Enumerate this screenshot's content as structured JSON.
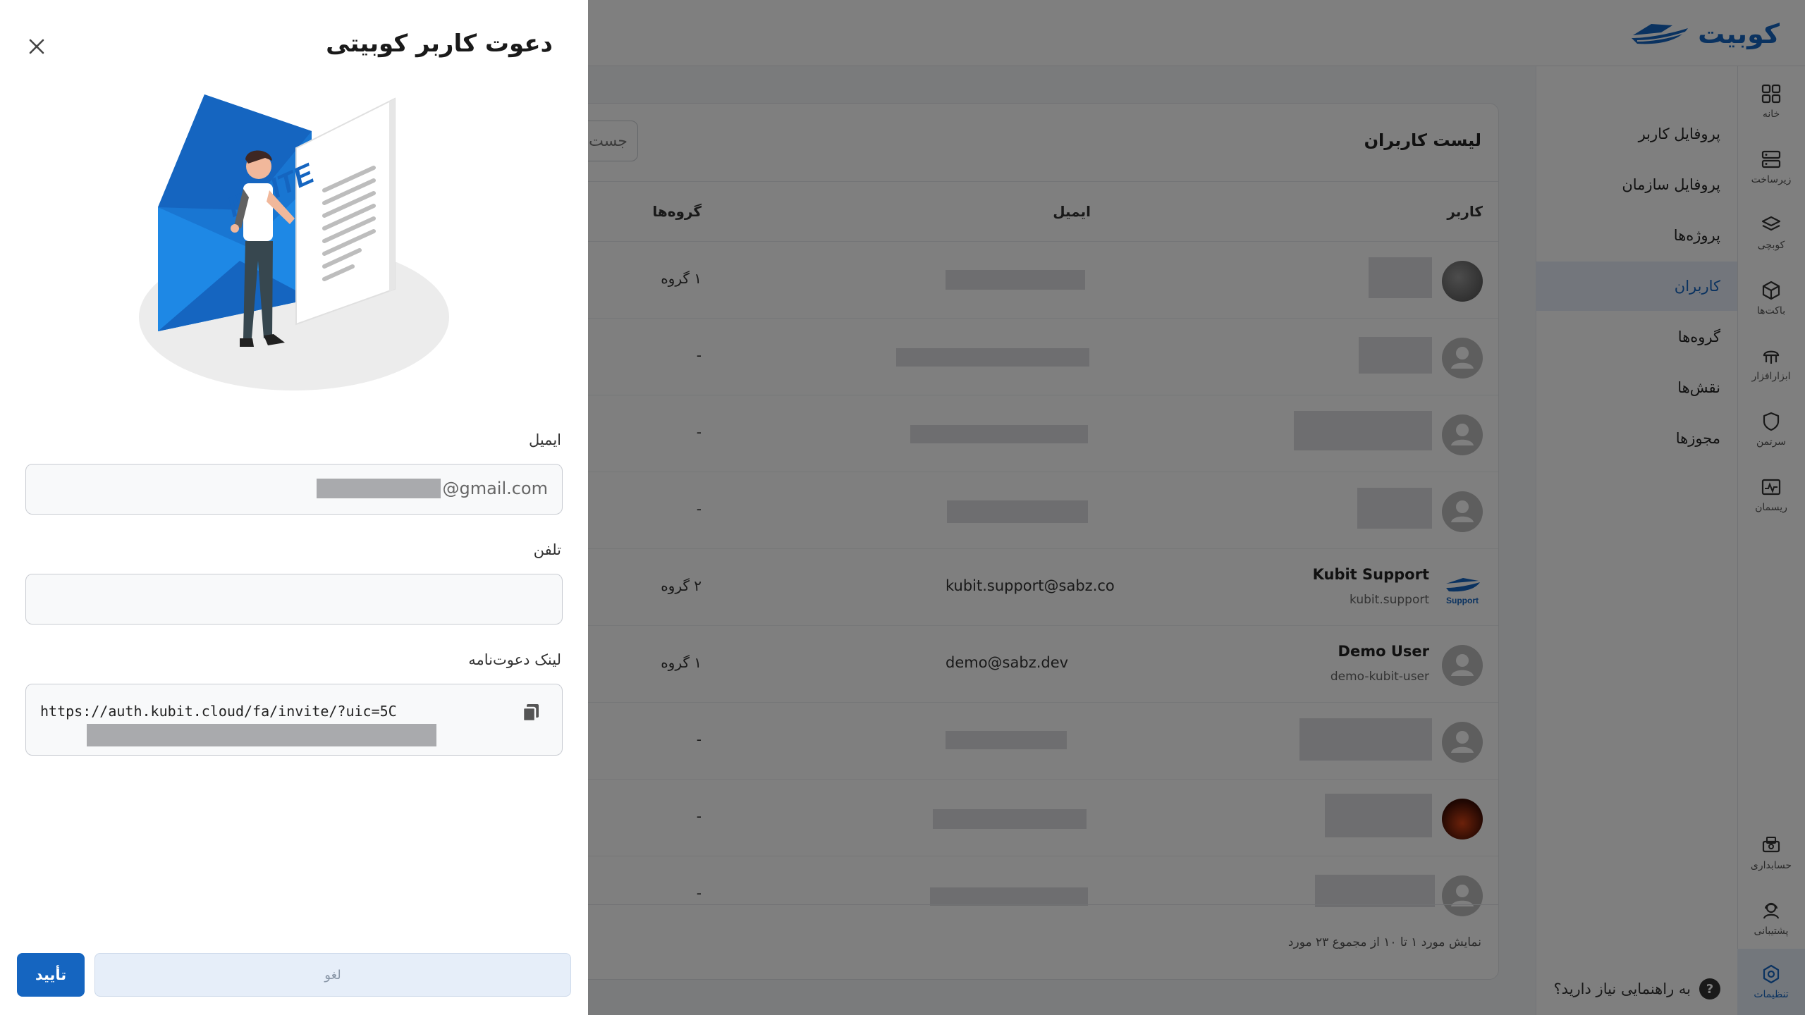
{
  "brand": {
    "name": "کوبیت",
    "color": "#1565c0"
  },
  "rail": {
    "items": [
      {
        "label": "خانه",
        "icon": "grid-icon"
      },
      {
        "label": "زیرساخت",
        "icon": "server-icon"
      },
      {
        "label": "کوبچی",
        "icon": "layers-icon"
      },
      {
        "label": "باکت‌ها",
        "icon": "box-icon"
      },
      {
        "label": "ابزارافزار",
        "icon": "tools-icon"
      },
      {
        "label": "سرتمن",
        "icon": "shield-icon"
      },
      {
        "label": "ریسمان",
        "icon": "monitor-icon"
      },
      {
        "label": "حسابداری",
        "icon": "billing-icon"
      },
      {
        "label": "پشتیبانی",
        "icon": "support-icon"
      },
      {
        "label": "تنظیمات",
        "icon": "settings-icon"
      }
    ]
  },
  "settings_nav": {
    "items": [
      "پروفایل کاربر",
      "پروفایل سازمان",
      "پروژه‌ها",
      "کاربران",
      "گروه‌ها",
      "نقش‌ها",
      "مجوزها"
    ],
    "active": "کاربران",
    "help_text": "به راهنمایی نیاز دارید؟",
    "help_icon": "?"
  },
  "users_list": {
    "title": "لیست کاربران",
    "search_placeholder": "جست",
    "columns": {
      "user": "کاربر",
      "email": "ایمیل",
      "groups": "گروه‌ها"
    },
    "rows": [
      {
        "name": "",
        "username": "",
        "email": "",
        "groups": "۱ گروه",
        "avatar": "photo"
      },
      {
        "name": "",
        "username": "",
        "email": "",
        "groups": "-",
        "avatar": "default"
      },
      {
        "name": "",
        "username": "",
        "email": "",
        "groups": "-",
        "avatar": "default"
      },
      {
        "name": "",
        "username": "",
        "email": "",
        "groups": "-",
        "avatar": "default"
      },
      {
        "name": "Kubit Support",
        "username": "kubit.support",
        "email": "kubit.support@sabz.co",
        "groups": "۲ گروه",
        "avatar": "support"
      },
      {
        "name": "Demo User",
        "username": "demo-kubit-user",
        "email": "demo@sabz.dev",
        "groups": "۱ گروه",
        "avatar": "default"
      },
      {
        "name": "",
        "username": "",
        "email": "",
        "groups": "-",
        "avatar": "default"
      },
      {
        "name": "",
        "username": "",
        "email": "",
        "groups": "-",
        "avatar": "fire"
      },
      {
        "name": "",
        "username": "",
        "email": "",
        "groups": "-",
        "avatar": "default"
      }
    ],
    "footer": "نمایش مورد ۱ تا ۱۰ از مجموع ۲۳ مورد"
  },
  "invite_drawer": {
    "title": "دعوت کاربر کوبیتی",
    "illustration_text": "INVITE",
    "email_label": "ایمیل",
    "email_value": "@gmail.com",
    "phone_label": "تلفن",
    "phone_value": "",
    "link_label": "لینک دعوت‌نامه",
    "link_value": "https://auth.kubit.cloud/fa/invite/?uic=5C",
    "confirm_label": "تأیید",
    "cancel_label": "لغو"
  },
  "support_logo_text": "Support"
}
